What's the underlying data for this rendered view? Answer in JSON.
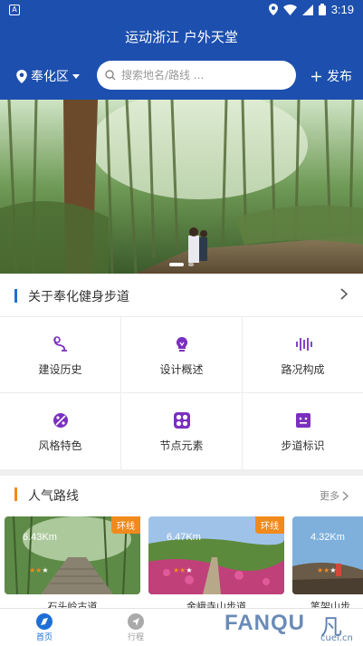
{
  "status_bar": {
    "time": "3:19",
    "app_icon_letter": "A"
  },
  "header": {
    "title": "运动浙江 户外天堂",
    "location": "奉化区",
    "search_placeholder": "搜索地名/路线 ...",
    "publish_label": "发布"
  },
  "banner": {
    "slide_count": 2,
    "active_index": 0
  },
  "about": {
    "title": "关于奉化健身步道",
    "items": [
      {
        "label": "建设历史",
        "icon": "history-icon"
      },
      {
        "label": "设计概述",
        "icon": "design-bulb-icon"
      },
      {
        "label": "路况构成",
        "icon": "road-condition-icon"
      },
      {
        "label": "风格特色",
        "icon": "style-feature-icon"
      },
      {
        "label": "节点元素",
        "icon": "node-element-icon"
      },
      {
        "label": "步道标识",
        "icon": "trail-sign-icon"
      }
    ]
  },
  "popular": {
    "title": "人气路线",
    "more_label": "更多",
    "routes": [
      {
        "name": "石头岭古道",
        "distance": "6.43Km",
        "tag": "环线",
        "stars": 2,
        "max_stars": 3
      },
      {
        "name": "金峨寺山步道",
        "distance": "6.47Km",
        "tag": "环线",
        "stars": 2,
        "max_stars": 3
      },
      {
        "name": "笔架山步",
        "distance": "4.32Km",
        "tag": "",
        "stars": 2,
        "max_stars": 3
      }
    ]
  },
  "tabs": [
    {
      "label": "首页",
      "active": true
    },
    {
      "label": "行程",
      "active": false
    }
  ],
  "watermark": {
    "latin": "FANQU",
    "chinese": "凡趣",
    "domain": "cuel.cn"
  },
  "colors": {
    "primary": "#1d4fae",
    "accent_blue": "#1d6fd6",
    "accent_orange": "#f08a1c",
    "icon_purple": "#7b2fbf"
  }
}
